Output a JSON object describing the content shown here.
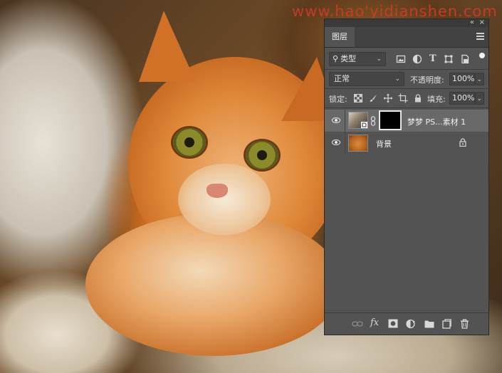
{
  "watermark": "www.hao'yidianshen.com",
  "panel": {
    "collapse_glyph": "«",
    "close_glyph": "×",
    "tab_label": "图层",
    "filter": {
      "search_glyph": "⚲",
      "kind_label": "类型",
      "filter_icons": [
        "image-filter-icon",
        "adjustment-filter-icon",
        "type-filter-icon",
        "shape-filter-icon",
        "smart-object-filter-icon"
      ],
      "type_glyph": "T"
    },
    "blend": {
      "mode": "正常",
      "opacity_label": "不透明度:",
      "opacity_value": "100%"
    },
    "lock": {
      "label": "锁定:",
      "fill_label": "填充:",
      "fill_value": "100%"
    },
    "layers": [
      {
        "name": "梦梦 PS...素材 1",
        "visible": true,
        "selected": true,
        "has_mask": true
      },
      {
        "name": "背景",
        "visible": true,
        "selected": false,
        "locked": true
      }
    ],
    "bottom_icons": [
      "link-layers-icon",
      "fx-icon",
      "add-mask-icon",
      "adjustment-layer-icon",
      "group-folder-icon",
      "new-layer-icon",
      "trash-icon"
    ],
    "fx_label": "fx"
  }
}
